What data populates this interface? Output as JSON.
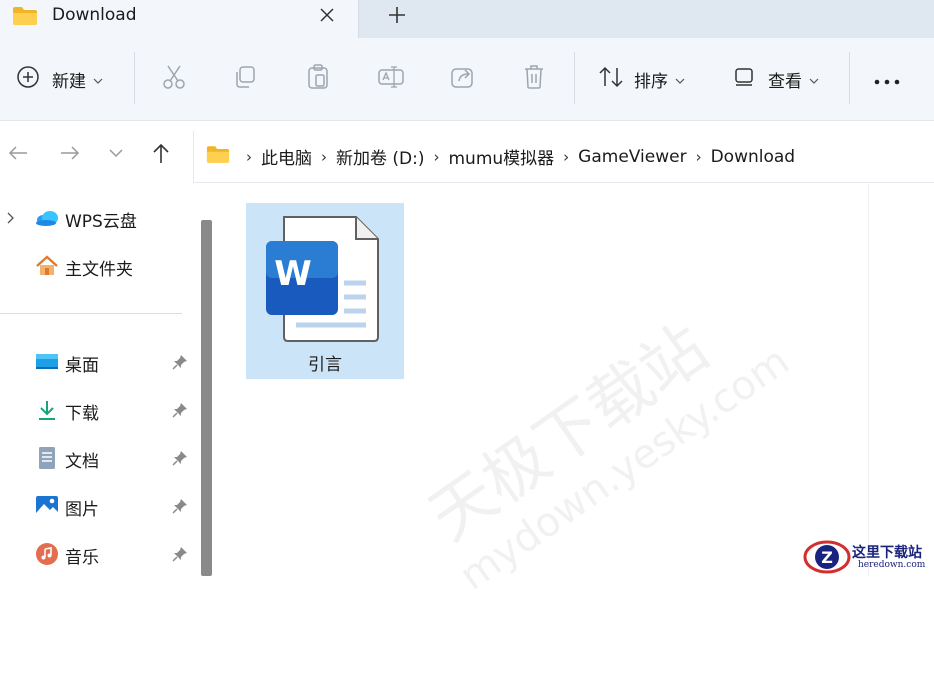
{
  "tab": {
    "title": "Download"
  },
  "toolbar": {
    "new_label": "新建",
    "sort_label": "排序",
    "view_label": "查看"
  },
  "address": {
    "crumbs": [
      "此电脑",
      "新加卷 (D:)",
      "mumu模拟器",
      "GameViewer",
      "Download"
    ]
  },
  "sidebar": {
    "top_items": [
      {
        "label": "WPS云盘",
        "icon": "cloud-icon"
      },
      {
        "label": "主文件夹",
        "icon": "home-icon"
      }
    ],
    "pinned_items": [
      {
        "label": "桌面",
        "icon": "desktop-icon"
      },
      {
        "label": "下载",
        "icon": "download-icon"
      },
      {
        "label": "文档",
        "icon": "document-icon"
      },
      {
        "label": "图片",
        "icon": "pictures-icon"
      },
      {
        "label": "音乐",
        "icon": "music-icon"
      }
    ]
  },
  "files": [
    {
      "name": "引言",
      "type": "word-document-icon",
      "selected": true
    }
  ],
  "watermark": {
    "line1": "天极下载站",
    "line2": "mydown.yesky.com"
  },
  "logo": {
    "name": "这里下载站",
    "url_text": "heredown.com"
  },
  "colors": {
    "accent": "#185abd",
    "selection": "#cce4f7",
    "chrome": "#f3f6fa"
  }
}
